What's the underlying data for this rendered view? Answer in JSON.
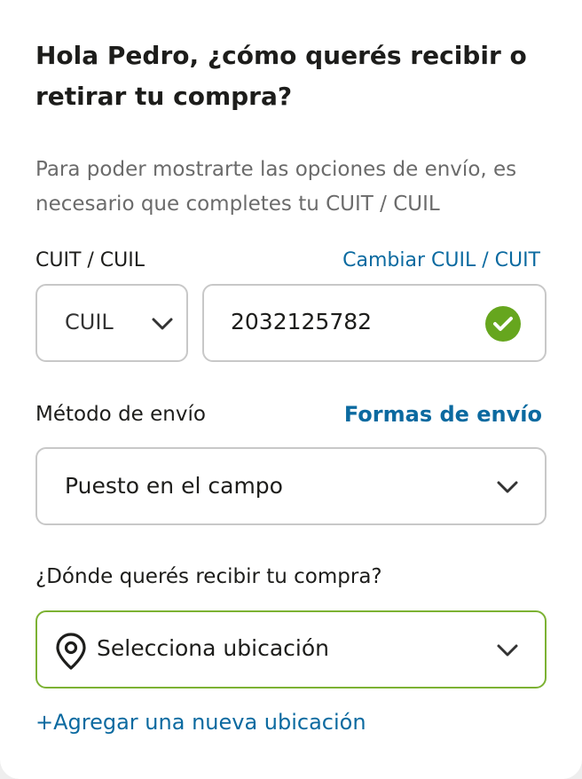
{
  "heading": "Hola Pedro, ¿cómo querés recibir o retirar tu compra?",
  "subtitle": "Para poder mostrarte las opciones de envío, es necesario que completes tu CUIT / CUIL",
  "cuit": {
    "label": "CUIT / CUIL",
    "change_link": "Cambiar CUIL / CUIT",
    "type_selected": "CUIL",
    "number_value": "2032125782",
    "valid_icon": "check-circle-icon"
  },
  "shipping": {
    "label": "Método de envío",
    "link": "Formas de envío",
    "selected": "Puesto en el campo"
  },
  "location": {
    "label": "¿Dónde querés recibir tu compra?",
    "placeholder": "Selecciona ubicación",
    "add_link": "+Agregar una nueva ubicación"
  },
  "colors": {
    "accent_link": "#0b6aa0",
    "valid_green": "#66a61e",
    "border": "#c8c8c8",
    "focus_border": "#7cb233"
  }
}
